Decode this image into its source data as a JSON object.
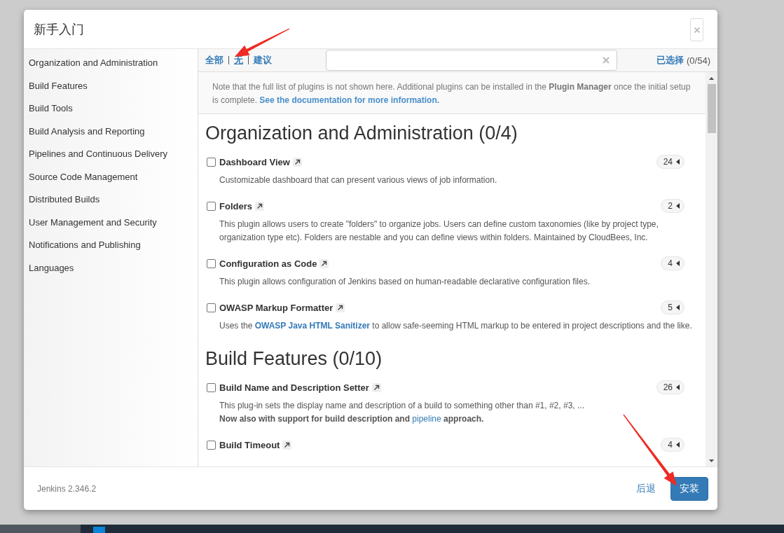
{
  "dialog": {
    "title": "新手入门"
  },
  "sidebar": {
    "items": [
      {
        "label": "Organization and Administration"
      },
      {
        "label": "Build Features"
      },
      {
        "label": "Build Tools"
      },
      {
        "label": "Build Analysis and Reporting"
      },
      {
        "label": "Pipelines and Continuous Delivery"
      },
      {
        "label": "Source Code Management"
      },
      {
        "label": "Distributed Builds"
      },
      {
        "label": "User Management and Security"
      },
      {
        "label": "Notifications and Publishing"
      },
      {
        "label": "Languages"
      }
    ]
  },
  "toolbar": {
    "filters": [
      {
        "label": "全部",
        "selected": false
      },
      {
        "label": "无",
        "selected": true
      },
      {
        "label": "建议",
        "selected": false
      }
    ],
    "selected_link": "已选择",
    "selected_count": "(0/54)"
  },
  "note": [
    {
      "kind": "text",
      "text": "Note that the full list of plugins is not shown here. Additional plugins can be installed in the "
    },
    {
      "kind": "bold",
      "text": "Plugin Manager"
    },
    {
      "kind": "text",
      "text": " once the initial setup is complete. "
    },
    {
      "kind": "link",
      "text": "See the documentation for more information."
    }
  ],
  "sections": [
    {
      "title": "Organization and Administration (0/4)",
      "plugins": [
        {
          "name": "Dashboard View",
          "checked": false,
          "count": "24",
          "description": [
            [
              {
                "kind": "text",
                "text": "Customizable dashboard that can present various views of job information."
              }
            ]
          ]
        },
        {
          "name": "Folders",
          "checked": false,
          "count": "2",
          "description": [
            [
              {
                "kind": "text",
                "text": "This plugin allows users to create \"folders\" to organize jobs. Users can define custom taxonomies (like by project type, organization type etc). Folders are nestable and you can define views within folders. Maintained by CloudBees, Inc."
              }
            ]
          ]
        },
        {
          "name": "Configuration as Code",
          "checked": false,
          "count": "4",
          "description": [
            [
              {
                "kind": "text",
                "text": "This plugin allows configuration of Jenkins based on human-readable declarative configuration files."
              }
            ]
          ]
        },
        {
          "name": "OWASP Markup Formatter",
          "checked": false,
          "count": "5",
          "description": [
            [
              {
                "kind": "text",
                "text": "Uses the "
              },
              {
                "kind": "link",
                "text": "OWASP Java HTML Sanitizer"
              },
              {
                "kind": "text",
                "text": " to allow safe-seeming HTML markup to be entered in project descriptions and the like."
              }
            ]
          ]
        }
      ]
    },
    {
      "title": "Build Features (0/10)",
      "plugins": [
        {
          "name": "Build Name and Description Setter",
          "checked": false,
          "count": "26",
          "description": [
            [
              {
                "kind": "text",
                "text": "This plug-in sets the display name and description of a build to something other than #1, #2, #3, ..."
              }
            ],
            [
              {
                "kind": "bold",
                "text": "Now also with support for build description and "
              },
              {
                "kind": "plain_link",
                "text": "pipeline"
              },
              {
                "kind": "bold",
                "text": " approach."
              }
            ]
          ]
        },
        {
          "name": "Build Timeout",
          "checked": false,
          "count": "4"
        }
      ]
    }
  ],
  "footer": {
    "version": "Jenkins 2.346.2",
    "back": "后退",
    "install": "安装"
  }
}
